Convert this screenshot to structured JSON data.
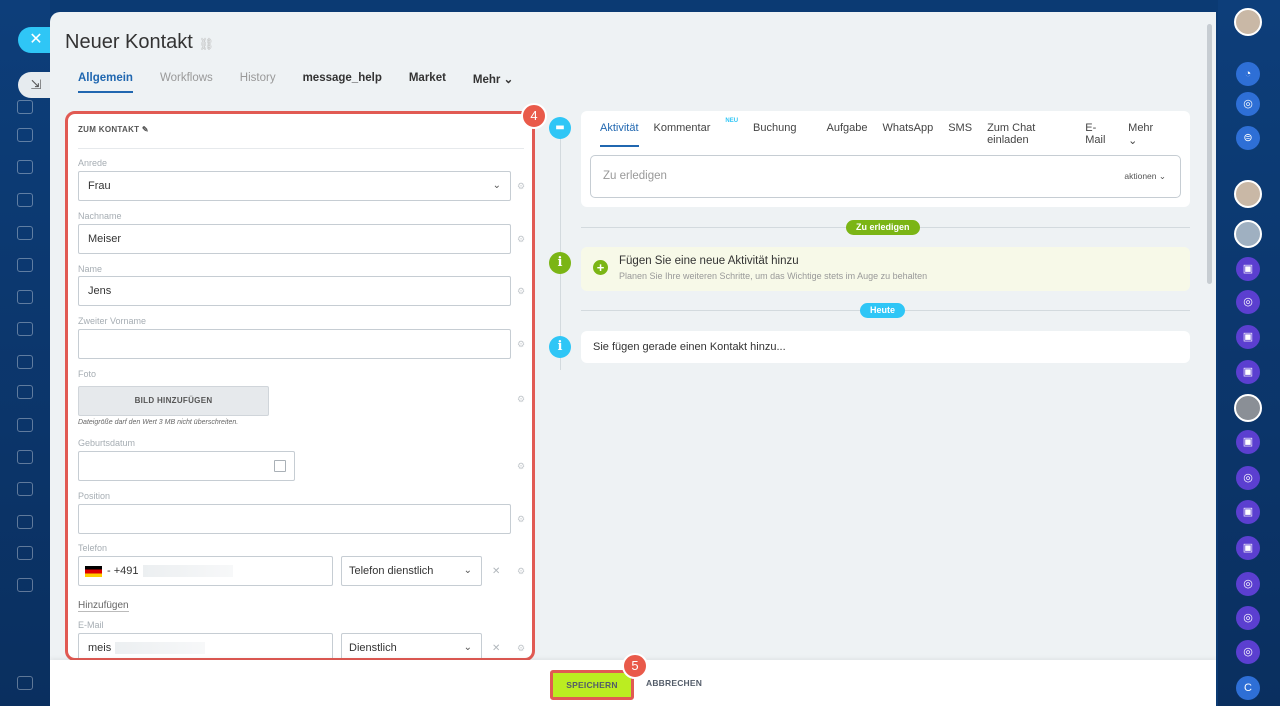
{
  "window": {
    "title": "Neuer Kontakt"
  },
  "tabs": [
    "Allgemein",
    "Workflows",
    "History",
    "message_help",
    "Market",
    "Mehr"
  ],
  "form": {
    "section_title": "ZUM KONTAKT",
    "anrede_label": "Anrede",
    "anrede_value": "Frau",
    "nachname_label": "Nachname",
    "nachname_value": "Meiser",
    "name_label": "Name",
    "name_value": "Jens",
    "zweiter_label": "Zweiter Vorname",
    "zweiter_value": "",
    "foto_label": "Foto",
    "foto_button": "BILD HINZUFÜGEN",
    "foto_hint": "Dateigröße darf den Wert 3 MB nicht überschreiten.",
    "geburtsdatum_label": "Geburtsdatum",
    "position_label": "Position",
    "telefon_label": "Telefon",
    "telefon_value": "- +491",
    "telefon_type": "Telefon dienstlich",
    "add_link": "Hinzufügen",
    "email_label": "E-Mail",
    "email_value": "meis",
    "email_type": "Dienstlich"
  },
  "timeline": {
    "tabs": [
      "Aktivität",
      "Kommentar",
      "Buchung",
      "Aufgabe",
      "WhatsApp",
      "SMS",
      "Zum Chat einladen",
      "E-Mail",
      "Mehr"
    ],
    "neu_badge": "NEU",
    "todo_placeholder": "Zu erledigen",
    "aktionen": "aktionen",
    "todo_chip": "Zu erledigen",
    "hint_title": "Fügen Sie eine neue Aktivität hinzu",
    "hint_sub": "Planen Sie Ihre weiteren Schritte, um das Wichtige stets im Auge zu behalten",
    "today_chip": "Heute",
    "info_text": "Sie fügen gerade einen Kontakt hinzu..."
  },
  "footer": {
    "save": "SPEICHERN",
    "cancel": "ABBRECHEN"
  },
  "badges": {
    "form": "4",
    "save": "5"
  },
  "right_rail": {
    "last_avatar": "C"
  },
  "colors": {
    "accent": "#2067b0",
    "save_green": "#bbed21",
    "highlight": "#e15a53",
    "todo_green": "#7bb515",
    "today_blue": "#2fc6f6"
  }
}
